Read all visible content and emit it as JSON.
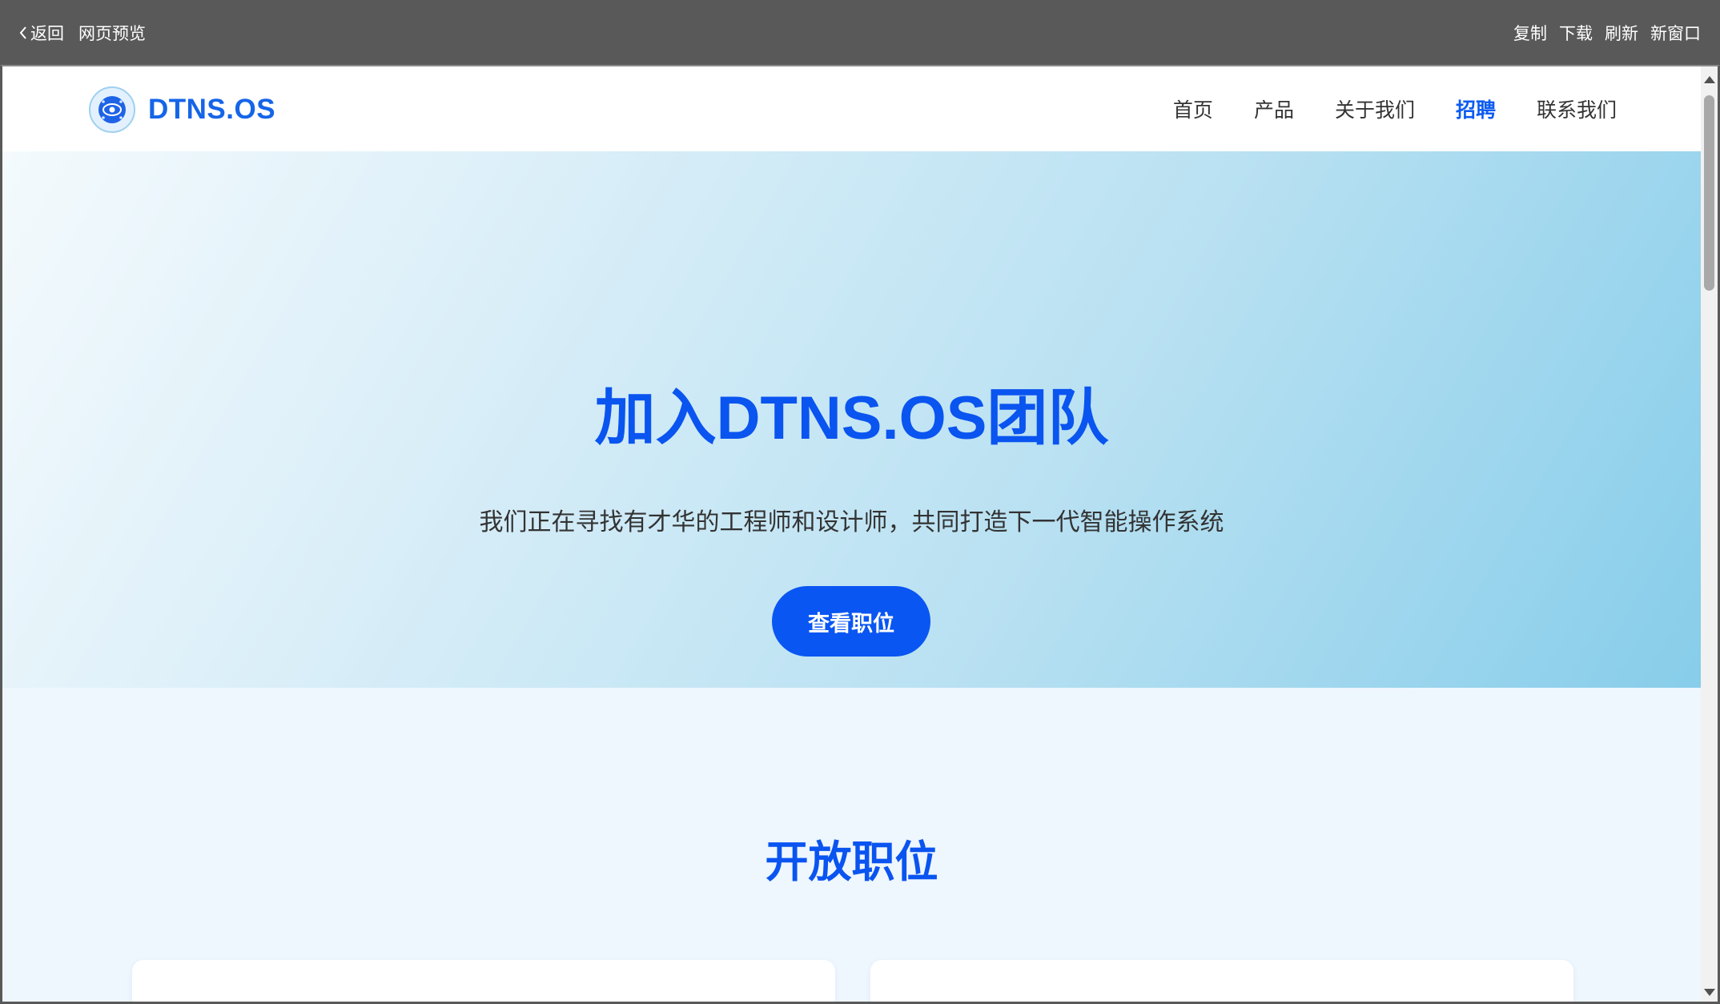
{
  "toolbar": {
    "back_label": "返回",
    "title": "网页预览",
    "actions": [
      "复制",
      "下载",
      "刷新",
      "新窗口"
    ]
  },
  "site": {
    "logo_text": "DTNS.OS",
    "nav": [
      {
        "label": "首页",
        "active": false
      },
      {
        "label": "产品",
        "active": false
      },
      {
        "label": "关于我们",
        "active": false
      },
      {
        "label": "招聘",
        "active": true
      },
      {
        "label": "联系我们",
        "active": false
      }
    ]
  },
  "hero": {
    "title": "加入DTNS.OS团队",
    "subtitle": "我们正在寻找有才华的工程师和设计师，共同打造下一代智能操作系统",
    "cta_label": "查看职位"
  },
  "positions": {
    "heading": "开放职位"
  },
  "colors": {
    "toolbar_bg": "#595959",
    "brand_blue": "#0a56f2",
    "section_bg": "#eef6fe",
    "hero_gradient_end": "#87cdea"
  }
}
